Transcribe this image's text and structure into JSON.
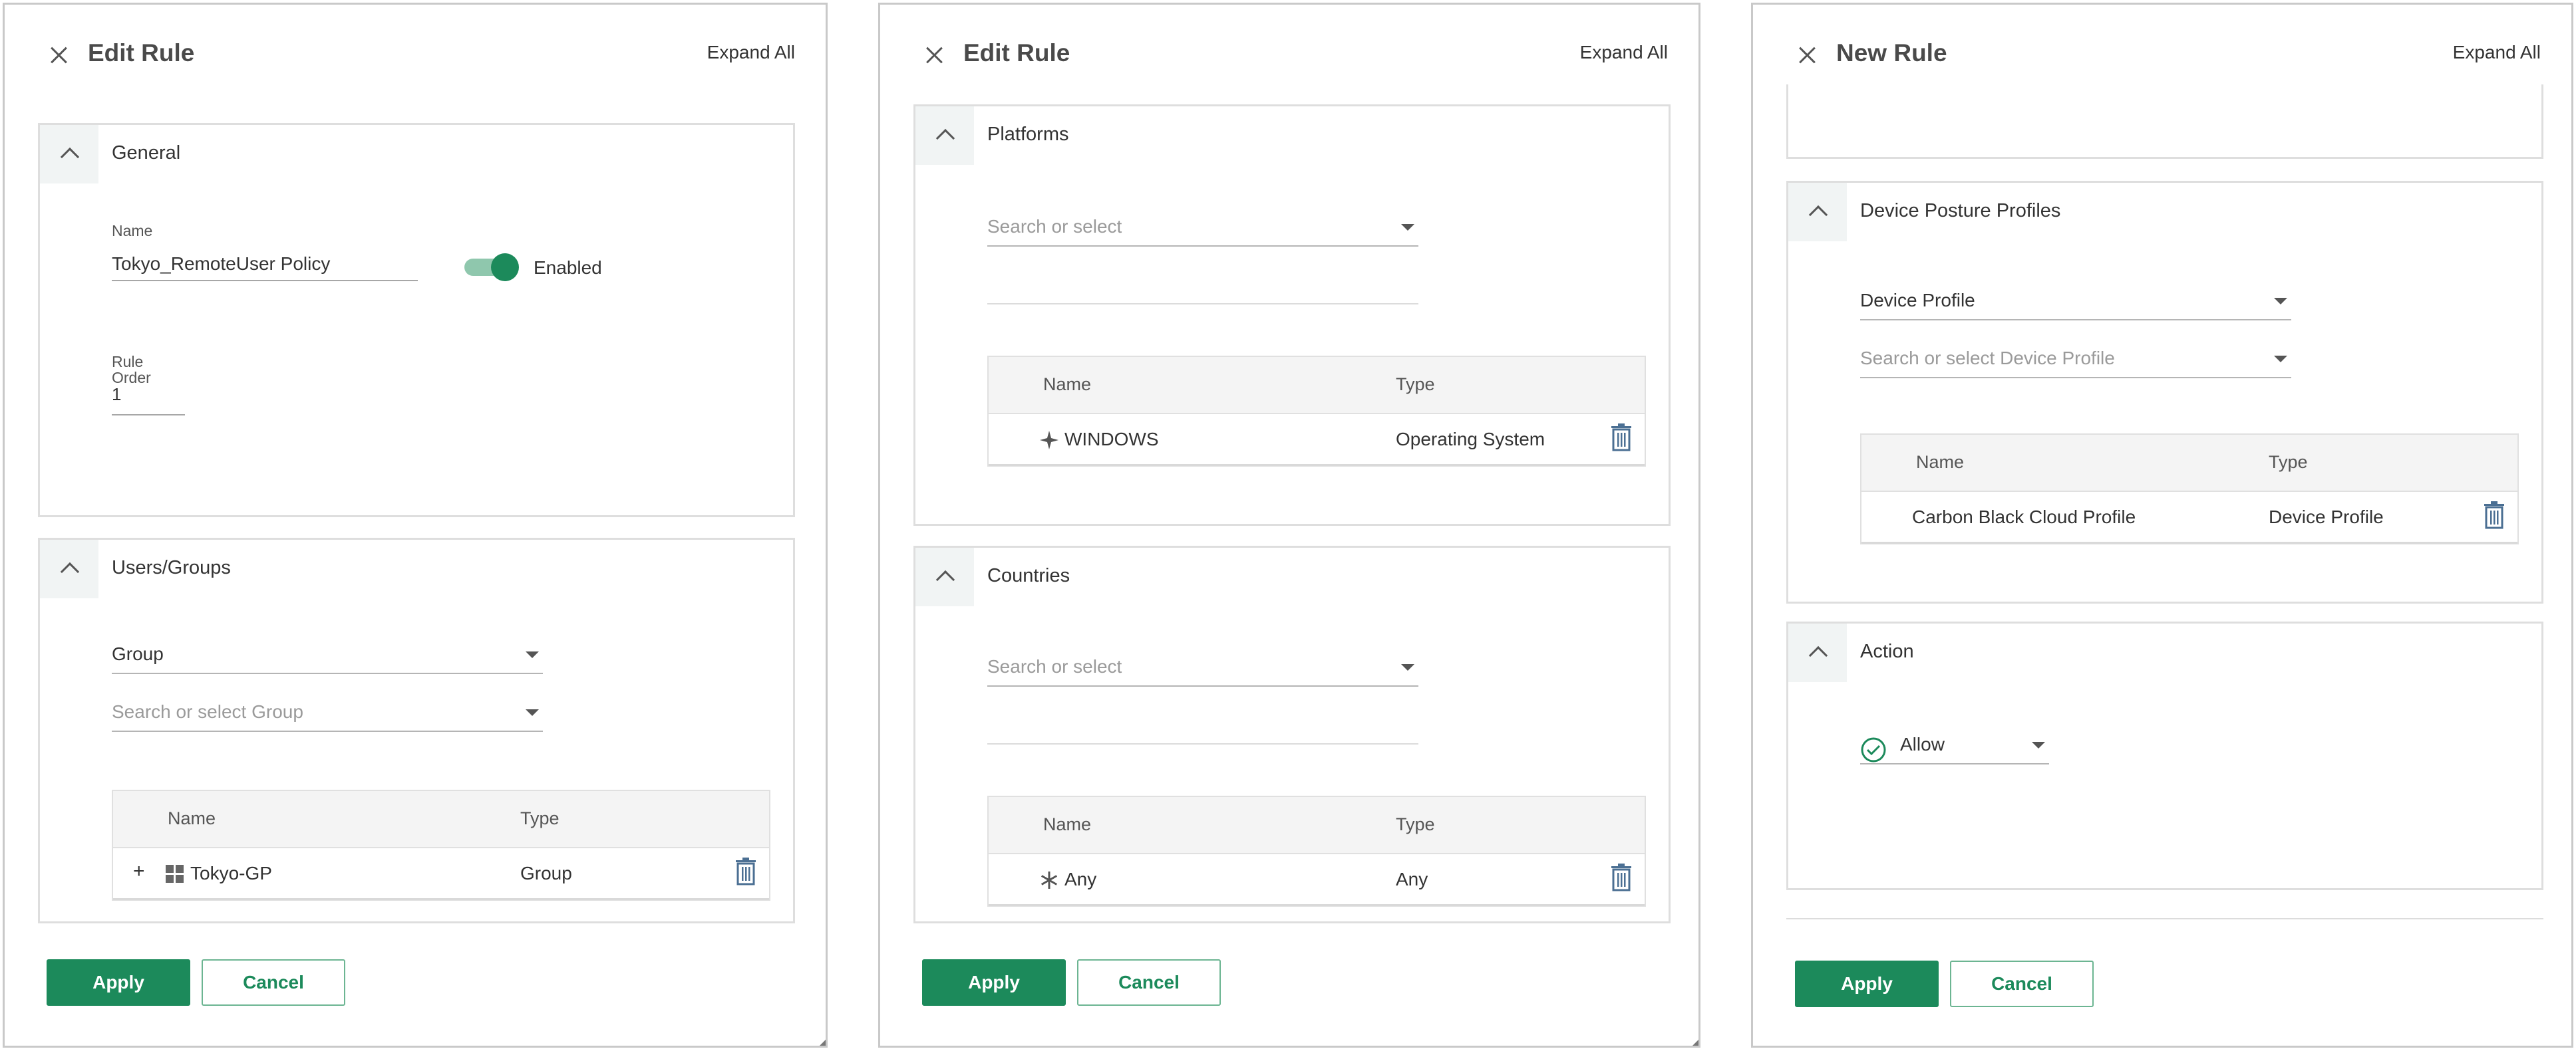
{
  "colors": {
    "accent": "#1c8a5b",
    "border": "#dedede",
    "text": "#333333",
    "placeholder": "#9a9a9a"
  },
  "common": {
    "expand_all": "Expand All",
    "apply": "Apply",
    "cancel": "Cancel",
    "name_col": "Name",
    "type_col": "Type"
  },
  "panel1": {
    "title": "Edit Rule",
    "general": {
      "title": "General",
      "name_label": "Name",
      "name_value": "Tokyo_RemoteUser Policy",
      "enabled_label": "Enabled",
      "enabled": true,
      "rule_label_1": "Rule",
      "rule_label_2": "Order",
      "rule_order": "1"
    },
    "users_groups": {
      "title": "Users/Groups",
      "selector_value": "Group",
      "search_placeholder": "Search or select Group",
      "row": {
        "name": "Tokyo-GP",
        "type": "Group",
        "icon": "group-grid-icon",
        "expand": "+"
      }
    }
  },
  "panel2": {
    "title": "Edit Rule",
    "platforms": {
      "title": "Platforms",
      "search_placeholder": "Search or select",
      "row": {
        "name": "WINDOWS",
        "type": "Operating System",
        "icon": "sparkle-icon"
      }
    },
    "countries": {
      "title": "Countries",
      "search_placeholder": "Search or select",
      "row": {
        "name": "Any",
        "type": "Any",
        "icon": "asterisk-icon"
      }
    }
  },
  "panel3": {
    "title": "New Rule",
    "device_posture": {
      "title": "Device Posture Profiles",
      "selector_value": "Device Profile",
      "search_placeholder": "Search or select Device Profile",
      "row": {
        "name": "Carbon Black Cloud Profile",
        "type": "Device Profile"
      }
    },
    "action": {
      "title": "Action",
      "value": "Allow",
      "icon": "check-circle-icon"
    }
  }
}
